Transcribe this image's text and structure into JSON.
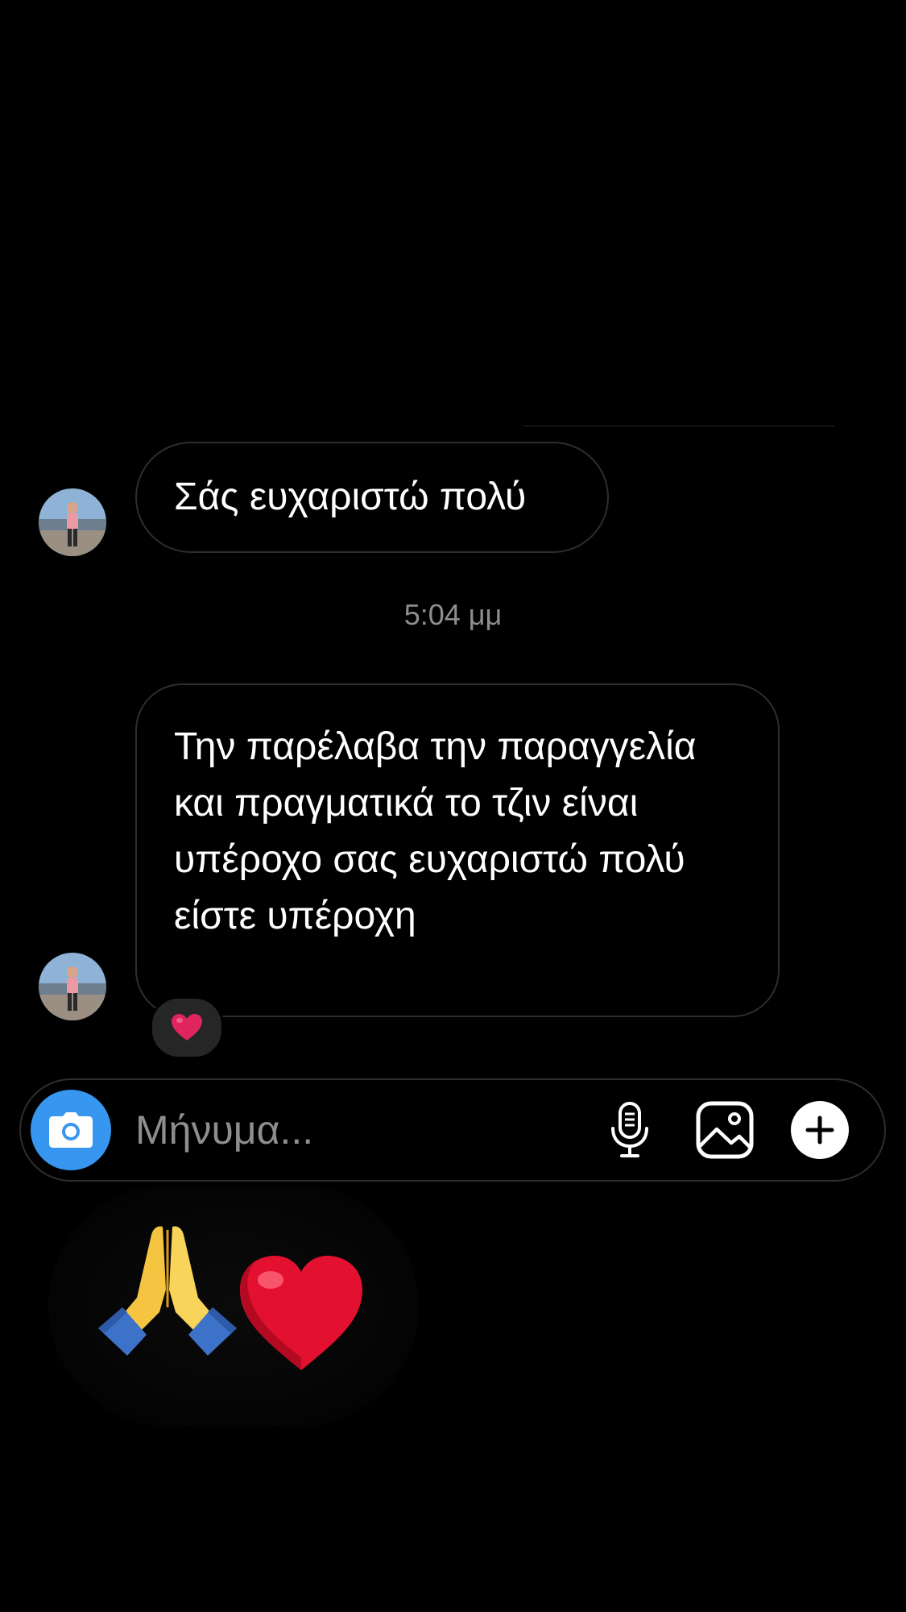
{
  "conversation": {
    "messages": [
      {
        "sender": "contact",
        "text": "Σάς ευχαριστώ πολύ"
      },
      {
        "sender": "contact",
        "text": "Την παρέλαβα την παραγγελία και πραγματικά το τζιν είναι υπέροχο σας ευχαριστώ πολύ είστε υπέροχη",
        "reaction": "heart-emoji"
      }
    ],
    "timestamp": "5:04 μμ"
  },
  "composer": {
    "placeholder": "Μήνυμα...",
    "camera_icon": "camera-icon",
    "mic_icon": "microphone-icon",
    "gallery_icon": "gallery-icon",
    "plus_icon": "plus-icon"
  },
  "quick_reactions": [
    "folded-hands-emoji",
    "red-heart-emoji"
  ],
  "colors": {
    "background": "#000000",
    "bubble_border": "#2e2e2e",
    "accent": "#3797f0",
    "muted_text": "#8e8e8e",
    "heart": "#e0245e"
  }
}
